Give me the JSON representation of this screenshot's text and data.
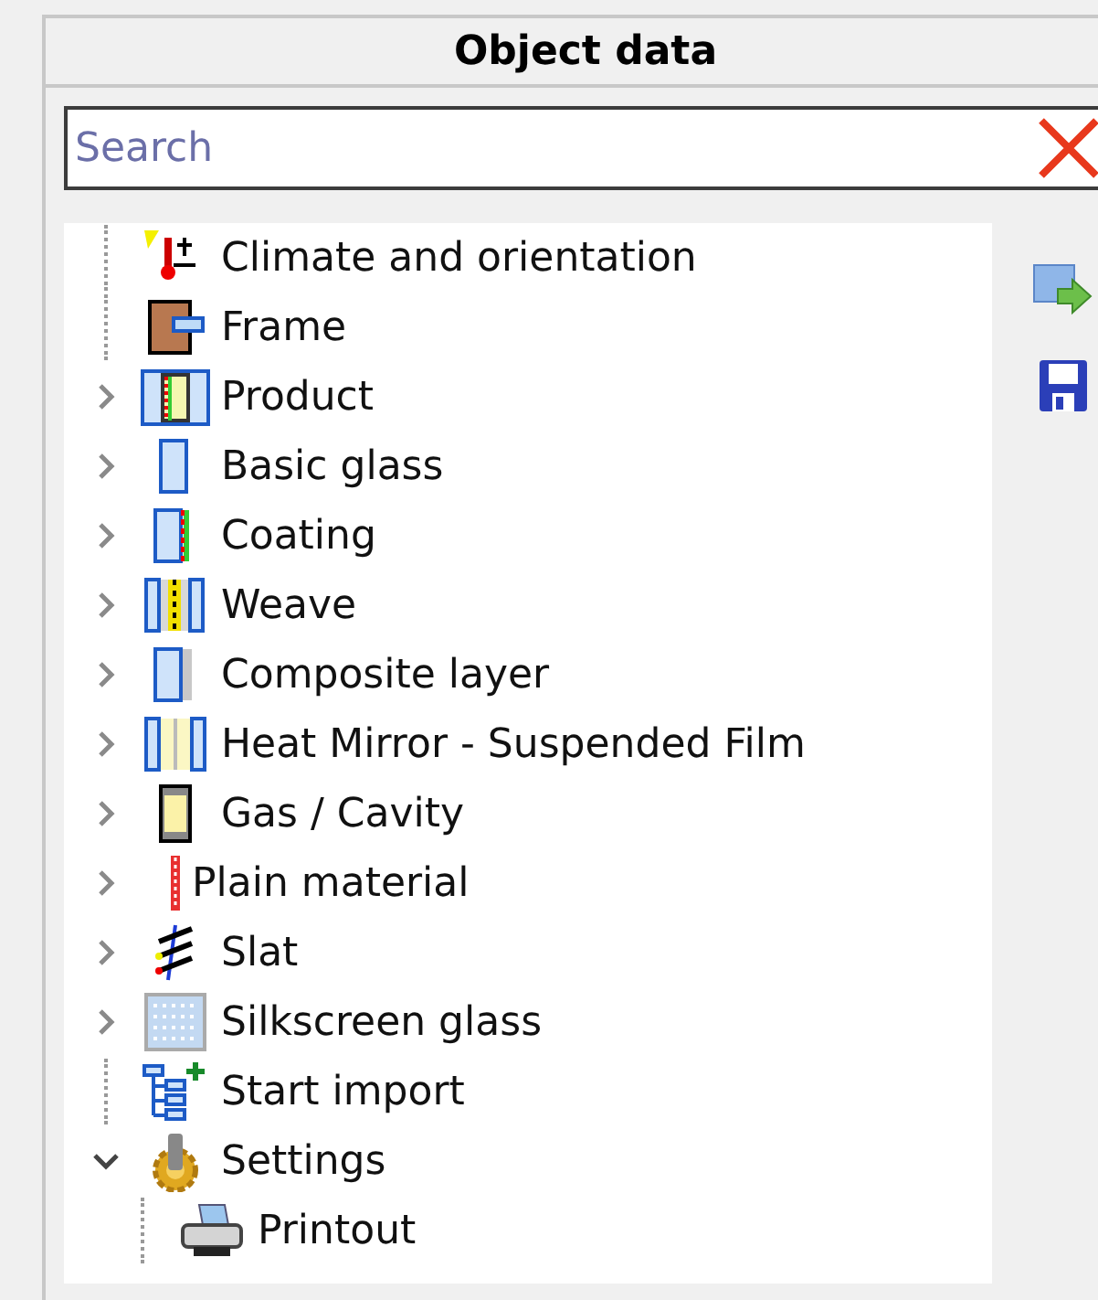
{
  "panel": {
    "title": "Object data"
  },
  "search": {
    "placeholder": "Search"
  },
  "tree": {
    "items": [
      {
        "label": "Climate and orientation",
        "kind": "climate"
      },
      {
        "label": "Frame",
        "kind": "frame"
      },
      {
        "label": "Product",
        "kind": "product",
        "expanded": false
      },
      {
        "label": "Basic glass",
        "kind": "glass",
        "expanded": false
      },
      {
        "label": "Coating",
        "kind": "coating",
        "expanded": false
      },
      {
        "label": "Weave",
        "kind": "weave",
        "expanded": false
      },
      {
        "label": "Composite layer",
        "kind": "composite",
        "expanded": false
      },
      {
        "label": "Heat Mirror - Suspended Film",
        "kind": "film",
        "expanded": false
      },
      {
        "label": "Gas / Cavity",
        "kind": "gas",
        "expanded": false
      },
      {
        "label": "Plain material",
        "kind": "plain",
        "expanded": false
      },
      {
        "label": "Slat",
        "kind": "slat",
        "expanded": false
      },
      {
        "label": "Silkscreen glass",
        "kind": "silkscreen",
        "expanded": false
      },
      {
        "label": "Start import",
        "kind": "import"
      },
      {
        "label": "Settings",
        "kind": "settings",
        "expanded": true,
        "children": [
          {
            "label": "Printout",
            "kind": "printer"
          }
        ]
      }
    ]
  }
}
